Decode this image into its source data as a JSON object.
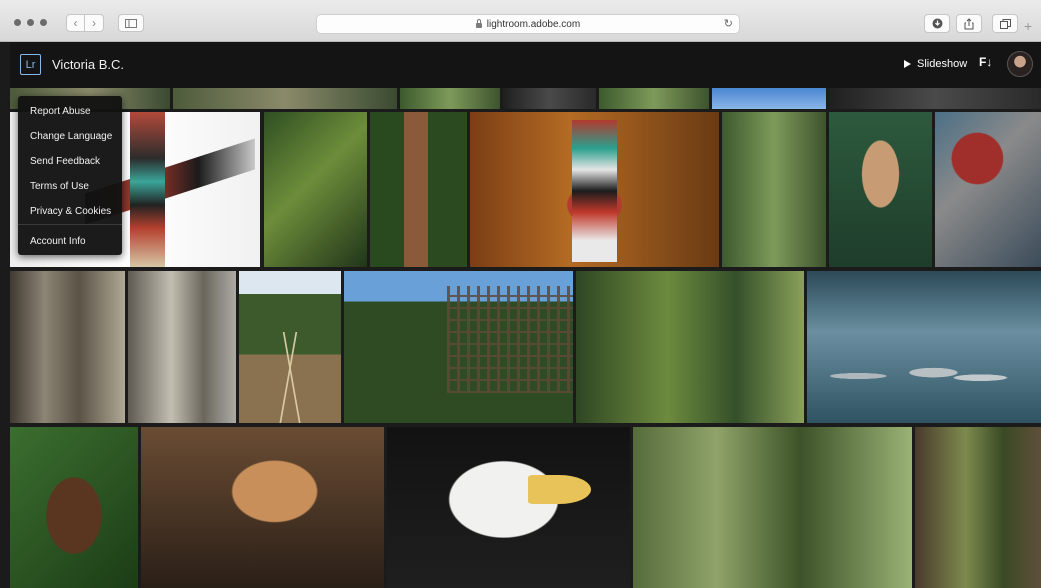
{
  "browser": {
    "url": "lightroom.adobe.com"
  },
  "header": {
    "app_logo": "Lr",
    "album_title": "Victoria B.C.",
    "slideshow_label": "Slideshow",
    "sort_icon_text": "F↓"
  },
  "menu": {
    "items": [
      {
        "label": "Report Abuse"
      },
      {
        "label": "Change Language"
      },
      {
        "label": "Send Feedback"
      },
      {
        "label": "Terms of Use"
      },
      {
        "label": "Privacy & Cookies"
      },
      {
        "label": "Account Info"
      }
    ]
  },
  "icons": {
    "back": "chevron-left-icon",
    "forward": "chevron-right-icon",
    "sidebar": "sidebar-icon",
    "lock": "lock-icon",
    "reload": "reload-icon",
    "download": "download-icon",
    "share": "share-icon",
    "tabs": "tabs-icon",
    "play": "play-icon",
    "sort": "sort-icon"
  },
  "colors": {
    "header_bg": "#141414",
    "lr_logo_blue": "#8bb6e9",
    "menu_bg": "#121212"
  }
}
